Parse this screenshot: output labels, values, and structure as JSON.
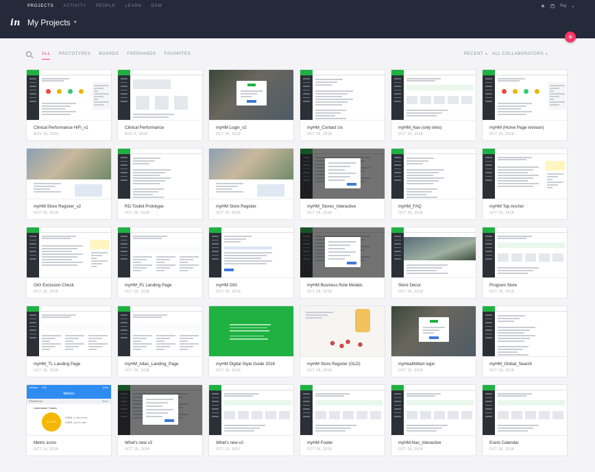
{
  "nav": {
    "items": [
      "PROJECTS",
      "ACTIVITY",
      "PEOPLE",
      "LEARN",
      "DSM"
    ],
    "active": 0,
    "right": {
      "bell_icon": "bell-icon",
      "store_icon": "store-icon",
      "user_label": "Raj"
    }
  },
  "header": {
    "logo": "in",
    "title": "My Projects",
    "add_button_label": "+"
  },
  "filters": {
    "tabs": [
      "ALL",
      "PROTOTYPES",
      "BOARDS",
      "FREEHANDS",
      "FAVORITES"
    ],
    "active": 0,
    "sort_label": "RECENT",
    "collaborators_label": "ALL COLLABORATORS"
  },
  "colors": {
    "accent": "#ff3366",
    "topbar": "#252a3a",
    "brand_green": "#1fb141"
  },
  "projects": [
    {
      "name": "Clinical Performance HiFi_v1",
      "date": "NOV 16, 2018",
      "thumb": "dash-dots"
    },
    {
      "name": "Clinical Performance",
      "date": "NOV 6, 2018",
      "thumb": "wire"
    },
    {
      "name": "myHM Login_v2",
      "date": "OCT 26, 2018",
      "thumb": "photo-modal"
    },
    {
      "name": "myHM_Contact Us",
      "date": "OCT 26, 2018",
      "thumb": "text-page"
    },
    {
      "name": "myHM_Nav (only links)",
      "date": "OCT 26, 2018",
      "thumb": "cards"
    },
    {
      "name": "myHM (Home Page revision)",
      "date": "OCT 26, 2018",
      "thumb": "dash-dots"
    },
    {
      "name": "myHM Store Register_v2",
      "date": "OCT 26, 2018",
      "thumb": "photo-text"
    },
    {
      "name": "RD-Toolkit Prototype",
      "date": "OCT 26, 2018",
      "thumb": "text-page"
    },
    {
      "name": "myHM Store Register",
      "date": "OCT 26, 2018",
      "thumb": "photo-text"
    },
    {
      "name": "myHM_Stores_Interactive",
      "date": "OCT 26, 2018",
      "thumb": "dark-modal"
    },
    {
      "name": "myHM_FAQ",
      "date": "OCT 26, 2018",
      "thumb": "text-page"
    },
    {
      "name": "myHM Top Anchor",
      "date": "OCT 26, 2018",
      "thumb": "side-note"
    },
    {
      "name": "OIG Exclusion Check",
      "date": "OCT 26, 2018",
      "thumb": "side-note"
    },
    {
      "name": "myHM_PL Landing Page",
      "date": "OCT 26, 2018",
      "thumb": "columns"
    },
    {
      "name": "myHM OIG",
      "date": "OCT 26, 2018",
      "thumb": "table"
    },
    {
      "name": "myHM Business Role Modals",
      "date": "OCT 26, 2018",
      "thumb": "dark-modal"
    },
    {
      "name": "Store Décor",
      "date": "OCT 26, 2018",
      "thumb": "store-photo"
    },
    {
      "name": "Program Store",
      "date": "OCT 26, 2018",
      "thumb": "cards"
    },
    {
      "name": "myHM_TL Landing Page",
      "date": "OCT 26, 2018",
      "thumb": "columns"
    },
    {
      "name": "myHM_Atlas_Landing_Page",
      "date": "OCT 26, 2018",
      "thumb": "columns"
    },
    {
      "name": "myHM Digital Style Guide 2018",
      "date": "OCT 26, 2018",
      "thumb": "green"
    },
    {
      "name": "myHM Store Register (OLD)",
      "date": "OCT 26, 2018",
      "thumb": "pills"
    },
    {
      "name": "myHealthMart login",
      "date": "OCT 26, 2018",
      "thumb": "photo-modal"
    },
    {
      "name": "myHM_Global_Search",
      "date": "OCT 26, 2018",
      "thumb": "text-page"
    },
    {
      "name": "Metric icons",
      "date": "OCT 19, 2018",
      "thumb": "mobile"
    },
    {
      "name": "What's new v3",
      "date": "OCT 18, 2018",
      "thumb": "dark-modal"
    },
    {
      "name": "What's new v2",
      "date": "OCT 23, 2017",
      "thumb": "cards"
    },
    {
      "name": "myHM Footer",
      "date": "OCT 26, 2018",
      "thumb": "cards"
    },
    {
      "name": "myHM-Nav_interactive",
      "date": "OCT 26, 2018",
      "thumb": "cards"
    },
    {
      "name": "Event Calendar",
      "date": "OCT 26, 2018",
      "thumb": "cards"
    }
  ],
  "mobile_thumb": {
    "carrier": "Verizon",
    "network": "LTE",
    "battery": "24%",
    "app_title": "Metrics",
    "section": "FINANCIAL",
    "section_link": "Sort",
    "item_title": "Underwater Claims",
    "ring_value": "11.23%",
    "stat1": "0.00%",
    "stat1_label": "in last month",
    "stat2": "0.00%",
    "stat2_label": "year to date"
  }
}
